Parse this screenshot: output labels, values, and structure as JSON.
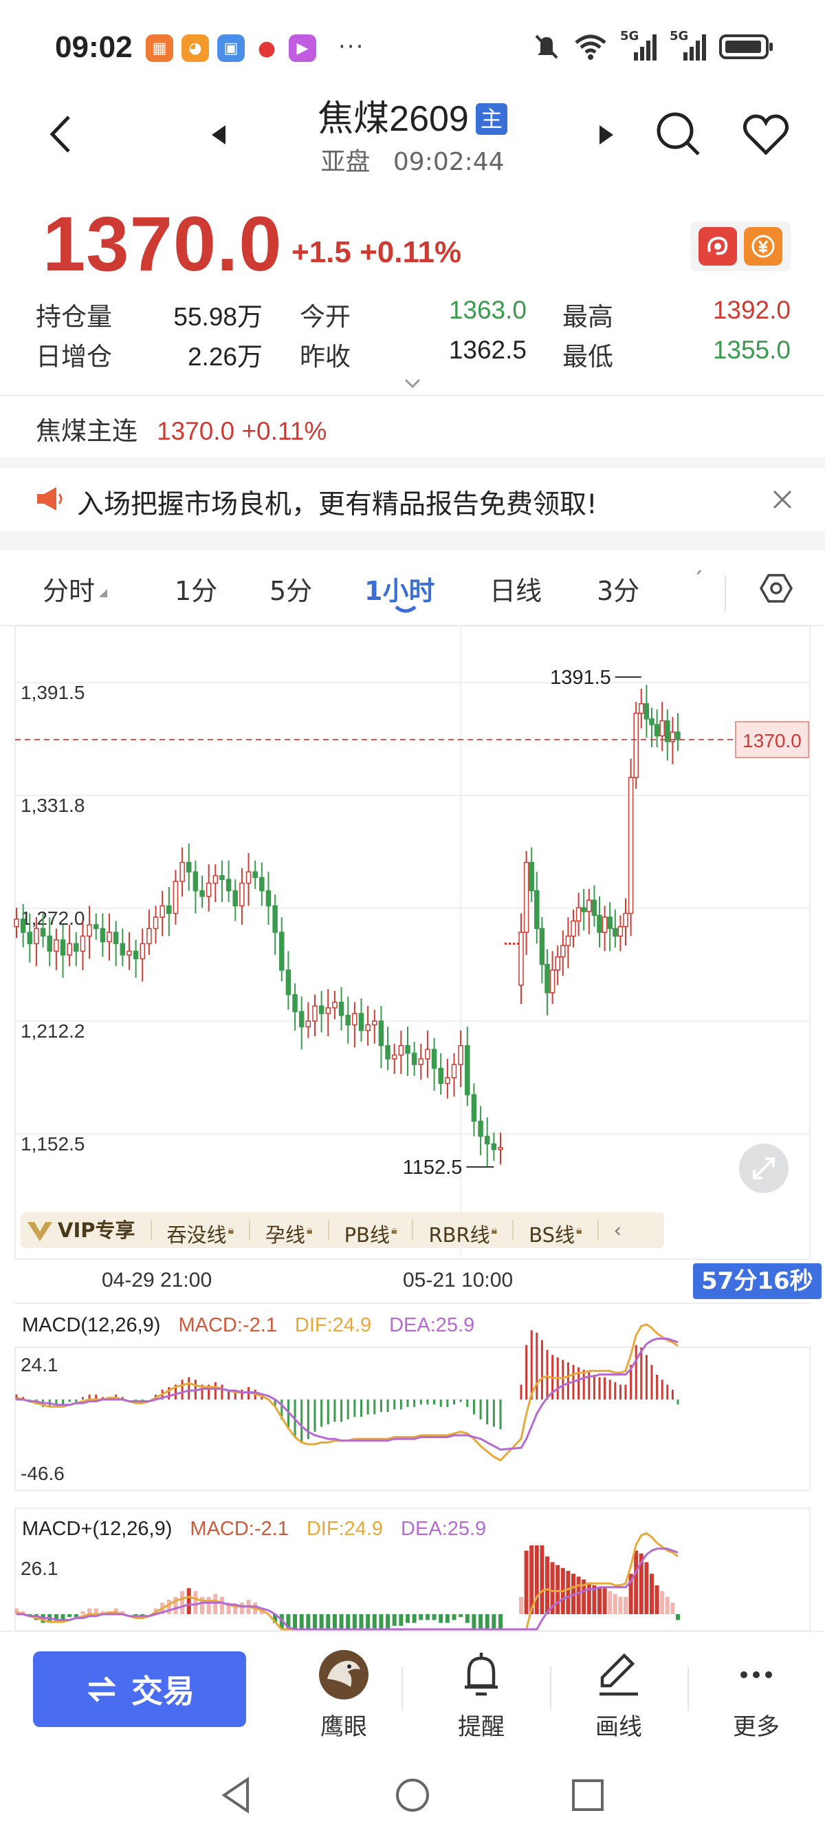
{
  "status_bar": {
    "time": "09:02",
    "dots": "···",
    "net1": "5G",
    "net2": "5G"
  },
  "header": {
    "title": "焦煤2609",
    "badge": "主",
    "market": "亚盘",
    "time": "09:02:44"
  },
  "quote": {
    "price": "1370.0",
    "change": "+1.5 +0.11%",
    "stats": [
      {
        "l1": "持仓量",
        "v1": "55.98万",
        "l2": "今开",
        "v2": "1363.0",
        "l3": "最高",
        "v3": "1392.0"
      },
      {
        "l1": "日增仓",
        "v1": "2.26万",
        "l2": "昨收",
        "v2": "1362.5",
        "l3": "最低",
        "v3": "1355.0"
      }
    ]
  },
  "main_contract": {
    "label": "焦煤主连",
    "value": "1370.0 +0.11%"
  },
  "ad": {
    "text": "入场把握市场良机，更有精品报告免费领取!"
  },
  "tabs": [
    {
      "label": "分时",
      "active": false
    },
    {
      "label": "1分",
      "active": false
    },
    {
      "label": "5分",
      "active": false
    },
    {
      "label": "1小时",
      "active": true
    },
    {
      "label": "日线",
      "active": false
    },
    {
      "label": "3分",
      "active": false
    }
  ],
  "colors": {
    "up": "#cd3b33",
    "down": "#3a9a4e",
    "accent": "#3b6fd8",
    "dif": "#e6a93a",
    "dea": "#b56ad1"
  },
  "chart_data": {
    "type": "candlestick",
    "title": "",
    "y_ticks": [
      "1,391.5",
      "1,331.8",
      "1,272.0",
      "1,212.2",
      "1,152.5"
    ],
    "y_range": [
      1152.5,
      1391.5
    ],
    "x_ticks": [
      "04-29 21:00",
      "05-21 10:00"
    ],
    "current_price": "1370.0",
    "high_annotation": "1391.5",
    "low_annotation": "1152.5",
    "countdown": "57分16秒",
    "close_series": [
      1275,
      1268,
      1262,
      1270,
      1266,
      1258,
      1264,
      1256,
      1262,
      1258,
      1266,
      1272,
      1270,
      1263,
      1268,
      1262,
      1256,
      1258,
      1254,
      1262,
      1270,
      1276,
      1282,
      1278,
      1295,
      1305,
      1300,
      1290,
      1287,
      1294,
      1298,
      1296,
      1290,
      1282,
      1294,
      1300,
      1297,
      1290,
      1282,
      1268,
      1248,
      1235,
      1226,
      1218,
      1221,
      1229,
      1225,
      1228,
      1231,
      1224,
      1219,
      1225,
      1216,
      1219,
      1221,
      1208,
      1201,
      1203,
      1208,
      1204,
      1198,
      1201,
      1206,
      1196,
      1188,
      1191,
      1198,
      1208,
      1182,
      1168,
      1160,
      1156,
      1153,
      1154,
      1268,
      1305,
      1290,
      1270,
      1251,
      1236,
      1248,
      1255,
      1261,
      1266,
      1274,
      1281,
      1279,
      1285,
      1277,
      1268,
      1276,
      1270,
      1266,
      1271,
      1278,
      1350,
      1384,
      1389,
      1381,
      1378,
      1372,
      1380,
      1369,
      1374,
      1370
    ]
  },
  "vip_bar": {
    "title": "VIP专享",
    "items": [
      "吞没线",
      "孕线",
      "PB线",
      "RBR线",
      "BS线"
    ]
  },
  "macd": {
    "legend": "MACD(12,26,9)",
    "macd": "MACD:-2.1",
    "dif": "DIF:24.9",
    "dea": "DEA:25.9",
    "max": "24.1",
    "min": "-46.6",
    "hist": [
      2,
      1,
      -1,
      -2,
      -3,
      -3,
      -2,
      -2,
      -1,
      -1,
      1,
      2,
      2,
      1,
      1,
      2,
      1,
      0,
      -1,
      -1,
      0,
      2,
      4,
      5,
      6,
      8,
      9,
      8,
      6,
      6,
      7,
      6,
      4,
      3,
      4,
      5,
      4,
      2,
      0,
      -3,
      -8,
      -12,
      -15,
      -17,
      -16,
      -13,
      -11,
      -10,
      -9,
      -9,
      -8,
      -7,
      -7,
      -6,
      -6,
      -5,
      -5,
      -4,
      -4,
      -3,
      -3,
      -2,
      -2,
      -2,
      -3,
      -3,
      -2,
      -1,
      -3,
      -6,
      -8,
      -10,
      -11,
      -12,
      6,
      22,
      28,
      27,
      24,
      20,
      18,
      17,
      16,
      15,
      14,
      13,
      12,
      11,
      10,
      9,
      9,
      8,
      7,
      6,
      6,
      14,
      22,
      21,
      18,
      14,
      10,
      8,
      6,
      4,
      -2
    ],
    "dif_series": [
      1,
      0,
      -1,
      -2,
      -3,
      -4,
      -4,
      -4,
      -3,
      -2,
      -1,
      0,
      0,
      0,
      1,
      1,
      0,
      -1,
      -2,
      -2,
      -1,
      1,
      3,
      5,
      7,
      8,
      9,
      8,
      7,
      7,
      7,
      6,
      5,
      4,
      4,
      4,
      3,
      2,
      0,
      -4,
      -10,
      -16,
      -21,
      -24,
      -25,
      -25,
      -24,
      -24,
      -23,
      -23,
      -23,
      -22,
      -22,
      -22,
      -22,
      -22,
      -22,
      -21,
      -21,
      -21,
      -21,
      -20,
      -20,
      -20,
      -20,
      -20,
      -19,
      -18,
      -19,
      -22,
      -26,
      -29,
      -32,
      -34,
      -22,
      -8,
      3,
      9,
      12,
      13,
      12,
      12,
      12,
      13,
      14,
      15,
      15,
      16,
      16,
      16,
      16,
      16,
      15,
      15,
      16,
      25,
      36,
      41,
      42,
      40,
      37,
      35,
      33,
      32,
      30
    ],
    "dea_series": [
      0,
      0,
      -1,
      -1,
      -2,
      -2,
      -3,
      -3,
      -3,
      -2,
      -2,
      -1,
      -1,
      0,
      0,
      0,
      0,
      -1,
      -1,
      -1,
      -1,
      0,
      1,
      2,
      3,
      4,
      5,
      5,
      6,
      6,
      6,
      6,
      5,
      5,
      4,
      4,
      4,
      3,
      2,
      0,
      -3,
      -7,
      -11,
      -15,
      -18,
      -20,
      -21,
      -22,
      -22,
      -23,
      -23,
      -23,
      -23,
      -23,
      -23,
      -23,
      -23,
      -22,
      -22,
      -22,
      -22,
      -21,
      -21,
      -21,
      -21,
      -21,
      -20,
      -20,
      -20,
      -21,
      -22,
      -24,
      -26,
      -28,
      -27,
      -22,
      -15,
      -8,
      -3,
      1,
      4,
      6,
      8,
      9,
      10,
      11,
      12,
      13,
      13,
      14,
      14,
      14,
      14,
      14,
      14,
      17,
      22,
      27,
      31,
      33,
      34,
      34,
      34,
      33,
      32
    ]
  },
  "macd_plus": {
    "legend": "MACD+(12,26,9)",
    "macd": "MACD:-2.1",
    "dif": "DIF:24.9",
    "dea": "DEA:25.9",
    "max": "26.1"
  },
  "bottom_bar": {
    "trade": "交易",
    "items": [
      "鹰眼",
      "提醒",
      "画线",
      "更多"
    ]
  }
}
